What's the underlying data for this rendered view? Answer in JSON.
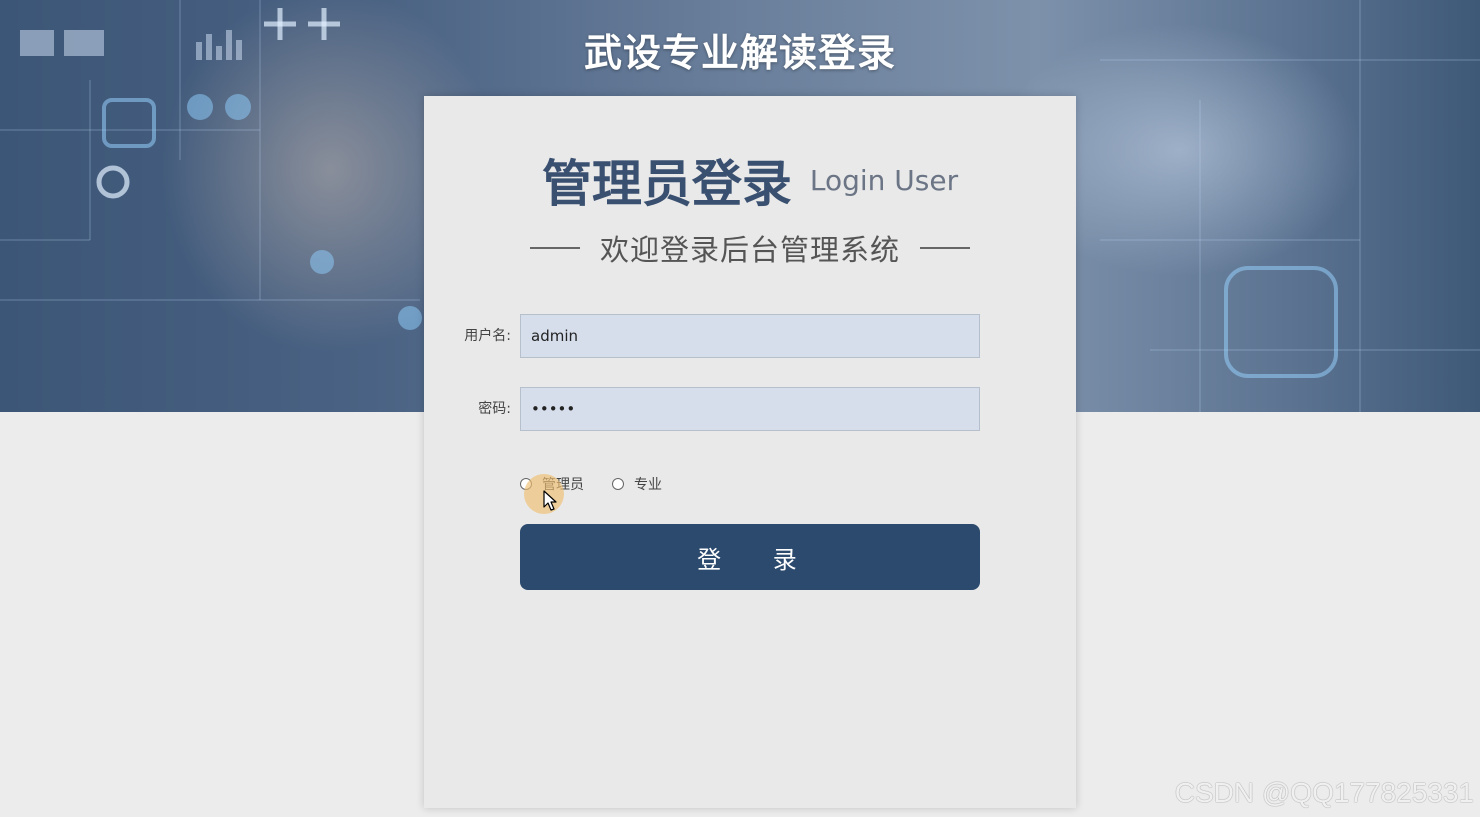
{
  "site": {
    "title": "武设专业解读登录"
  },
  "login_card": {
    "heading": "管理员登录",
    "heading_en": "Login User",
    "welcome": "欢迎登录后台管理系统"
  },
  "form": {
    "username_label": "用户名:",
    "username_value": "admin",
    "password_label": "密码:",
    "password_value": "•••••",
    "roles": [
      {
        "label": "管理员",
        "selected": false
      },
      {
        "label": "专业",
        "selected": false
      }
    ],
    "submit_label": "登 录"
  },
  "watermark": "CSDN @QQ177825331",
  "colors": {
    "primary": "#2b4a6e",
    "heading": "#3a5070",
    "input_bg": "#d6deec"
  }
}
